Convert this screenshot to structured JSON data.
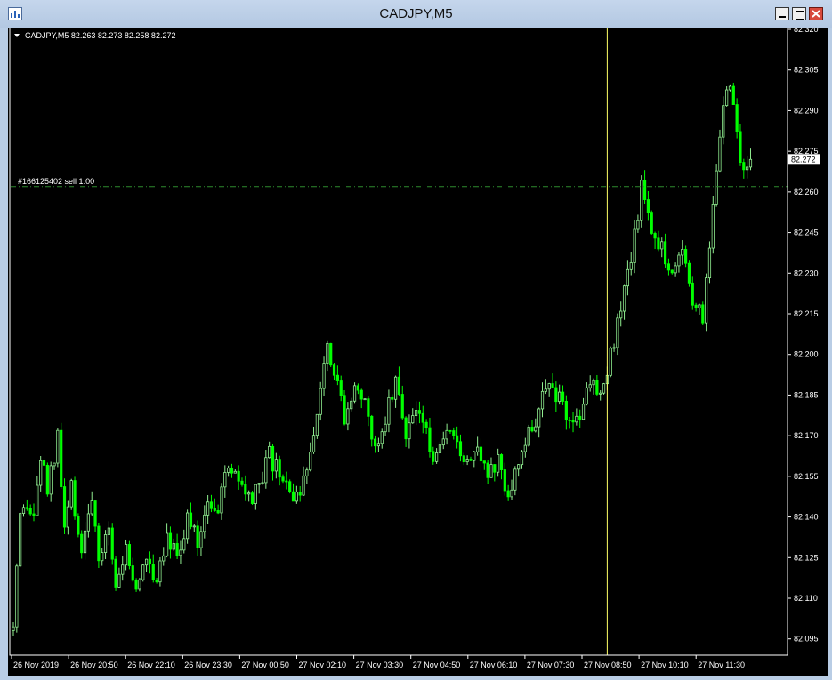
{
  "window": {
    "title": "CADJPY,M5"
  },
  "chart_data": {
    "type": "candlestick",
    "symbol_info": "CADJPY,M5  82.263 82.273 82.258 82.272",
    "title": "CADJPY,M5",
    "symbol": "CADJPY",
    "timeframe": "M5",
    "ohlc_header": {
      "open": 82.263,
      "high": 82.273,
      "low": 82.258,
      "close": 82.272
    },
    "current_price": "82.272",
    "ylim": [
      82.089,
      82.32
    ],
    "y_ticks": [
      "82.320",
      "82.305",
      "82.290",
      "82.275",
      "82.260",
      "82.245",
      "82.230",
      "82.215",
      "82.200",
      "82.185",
      "82.170",
      "82.155",
      "82.140",
      "82.125",
      "82.110",
      "82.095"
    ],
    "x_ticks": [
      "26 Nov 2019",
      "26 Nov 20:50",
      "26 Nov 22:10",
      "26 Nov 23:30",
      "27 Nov 00:50",
      "27 Nov 02:10",
      "27 Nov 03:30",
      "27 Nov 04:50",
      "27 Nov 06:10",
      "27 Nov 07:30",
      "27 Nov 08:50",
      "27 Nov 10:10",
      "27 Nov 11:30"
    ],
    "order_line": {
      "label": "#166125402 sell 1.00",
      "price": 82.262,
      "color": "#2e8b2e"
    },
    "period_separator_time_index": 174,
    "colors": {
      "background": "#000000",
      "bull_candle": "#90ee90",
      "bear_candle": "#00ff00",
      "foreground": "#ffffff",
      "price_line": "#2e8b2e",
      "separator": "#ffff66",
      "ask_box": "#ffffff"
    },
    "grid": false,
    "candles_note": "approximate M5 OHLC path estimated from image",
    "close_path": [
      [
        0,
        82.098
      ],
      [
        2,
        82.138
      ],
      [
        4,
        82.142
      ],
      [
        6,
        82.14
      ],
      [
        8,
        82.162
      ],
      [
        10,
        82.15
      ],
      [
        13,
        82.168
      ],
      [
        15,
        82.135
      ],
      [
        17,
        82.15
      ],
      [
        20,
        82.128
      ],
      [
        23,
        82.148
      ],
      [
        25,
        82.12
      ],
      [
        28,
        82.138
      ],
      [
        30,
        82.115
      ],
      [
        33,
        82.128
      ],
      [
        36,
        82.112
      ],
      [
        39,
        82.125
      ],
      [
        42,
        82.118
      ],
      [
        45,
        82.135
      ],
      [
        48,
        82.125
      ],
      [
        51,
        82.14
      ],
      [
        54,
        82.13
      ],
      [
        57,
        82.148
      ],
      [
        60,
        82.142
      ],
      [
        63,
        82.16
      ],
      [
        66,
        82.152
      ],
      [
        69,
        82.145
      ],
      [
        72,
        82.15
      ],
      [
        75,
        82.162
      ],
      [
        78,
        82.155
      ],
      [
        81,
        82.15
      ],
      [
        84,
        82.145
      ],
      [
        87,
        82.165
      ],
      [
        90,
        82.19
      ],
      [
        92,
        82.205
      ],
      [
        94,
        82.195
      ],
      [
        97,
        82.178
      ],
      [
        100,
        82.19
      ],
      [
        103,
        82.18
      ],
      [
        106,
        82.165
      ],
      [
        109,
        82.178
      ],
      [
        112,
        82.19
      ],
      [
        115,
        82.172
      ],
      [
        118,
        82.18
      ],
      [
        121,
        82.17
      ],
      [
        124,
        82.16
      ],
      [
        127,
        82.17
      ],
      [
        130,
        82.165
      ],
      [
        133,
        82.162
      ],
      [
        136,
        82.168
      ],
      [
        139,
        82.155
      ],
      [
        142,
        82.16
      ],
      [
        145,
        82.15
      ],
      [
        148,
        82.158
      ],
      [
        151,
        82.17
      ],
      [
        154,
        82.18
      ],
      [
        157,
        82.188
      ],
      [
        160,
        82.185
      ],
      [
        163,
        82.175
      ],
      [
        166,
        82.178
      ],
      [
        169,
        82.19
      ],
      [
        172,
        82.188
      ],
      [
        175,
        82.2
      ],
      [
        178,
        82.215
      ],
      [
        181,
        82.235
      ],
      [
        184,
        82.262
      ],
      [
        187,
        82.248
      ],
      [
        190,
        82.24
      ],
      [
        193,
        82.23
      ],
      [
        196,
        82.238
      ],
      [
        199,
        82.222
      ],
      [
        202,
        82.212
      ],
      [
        204,
        82.24
      ],
      [
        206,
        82.27
      ],
      [
        208,
        82.292
      ],
      [
        210,
        82.3
      ],
      [
        212,
        82.28
      ],
      [
        214,
        82.268
      ],
      [
        216,
        82.272
      ]
    ],
    "candle_count": 217,
    "plot_max_index": 225
  }
}
